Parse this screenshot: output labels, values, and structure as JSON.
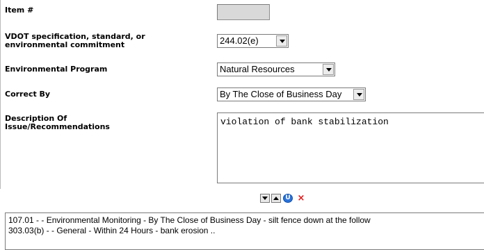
{
  "form": {
    "item_number_label": "Item #",
    "item_number_value": "",
    "spec_label_line1": "VDOT specification, standard, or",
    "spec_label_line2": "environmental commitment",
    "spec_value": "244.02(e)",
    "env_program_label": "Environmental Program",
    "env_program_value": "Natural Resources",
    "correct_by_label": "Correct By",
    "correct_by_value": "By The Close of Business Day",
    "description_label_line1": "Description Of",
    "description_label_line2": "Issue/Recommendations",
    "description_value": "violation of bank stabilization"
  },
  "list_controls": {
    "move_down_icon": "down-arrow-icon",
    "move_up_icon": "up-arrow-icon",
    "update_icon": "update-icon",
    "update_glyph": "U",
    "delete_icon": "red-x-icon",
    "delete_glyph": "×"
  },
  "list": {
    "items": [
      "107.01 -  - Environmental Monitoring - By The Close of Business Day - silt fence down at the follow",
      "303.03(b) -  - General - Within 24 Hours - bank erosion .."
    ]
  }
}
